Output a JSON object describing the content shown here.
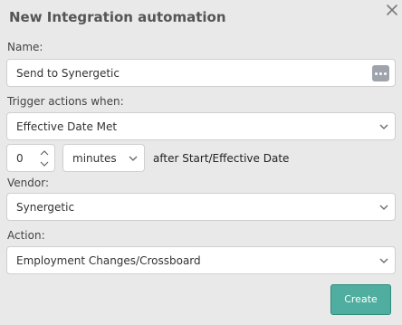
{
  "dialog": {
    "title": "New Integration automation",
    "close_icon": "close-icon"
  },
  "name": {
    "label": "Name:",
    "value": "Send to Synergetic",
    "more_icon": "ellipsis-icon"
  },
  "trigger": {
    "label": "Trigger actions when:",
    "selected": "Effective Date Met"
  },
  "offset": {
    "amount": "0",
    "unit": "minutes",
    "suffix": "after Start/Effective Date"
  },
  "vendor": {
    "label": "Vendor:",
    "selected": "Synergetic"
  },
  "action": {
    "label": "Action:",
    "selected": "Employment Changes/Crossboard"
  },
  "buttons": {
    "create": "Create"
  },
  "colors": {
    "background": "#e9e9e9",
    "primary_button": "#4fae9f",
    "more_button": "#9fa3ab"
  }
}
